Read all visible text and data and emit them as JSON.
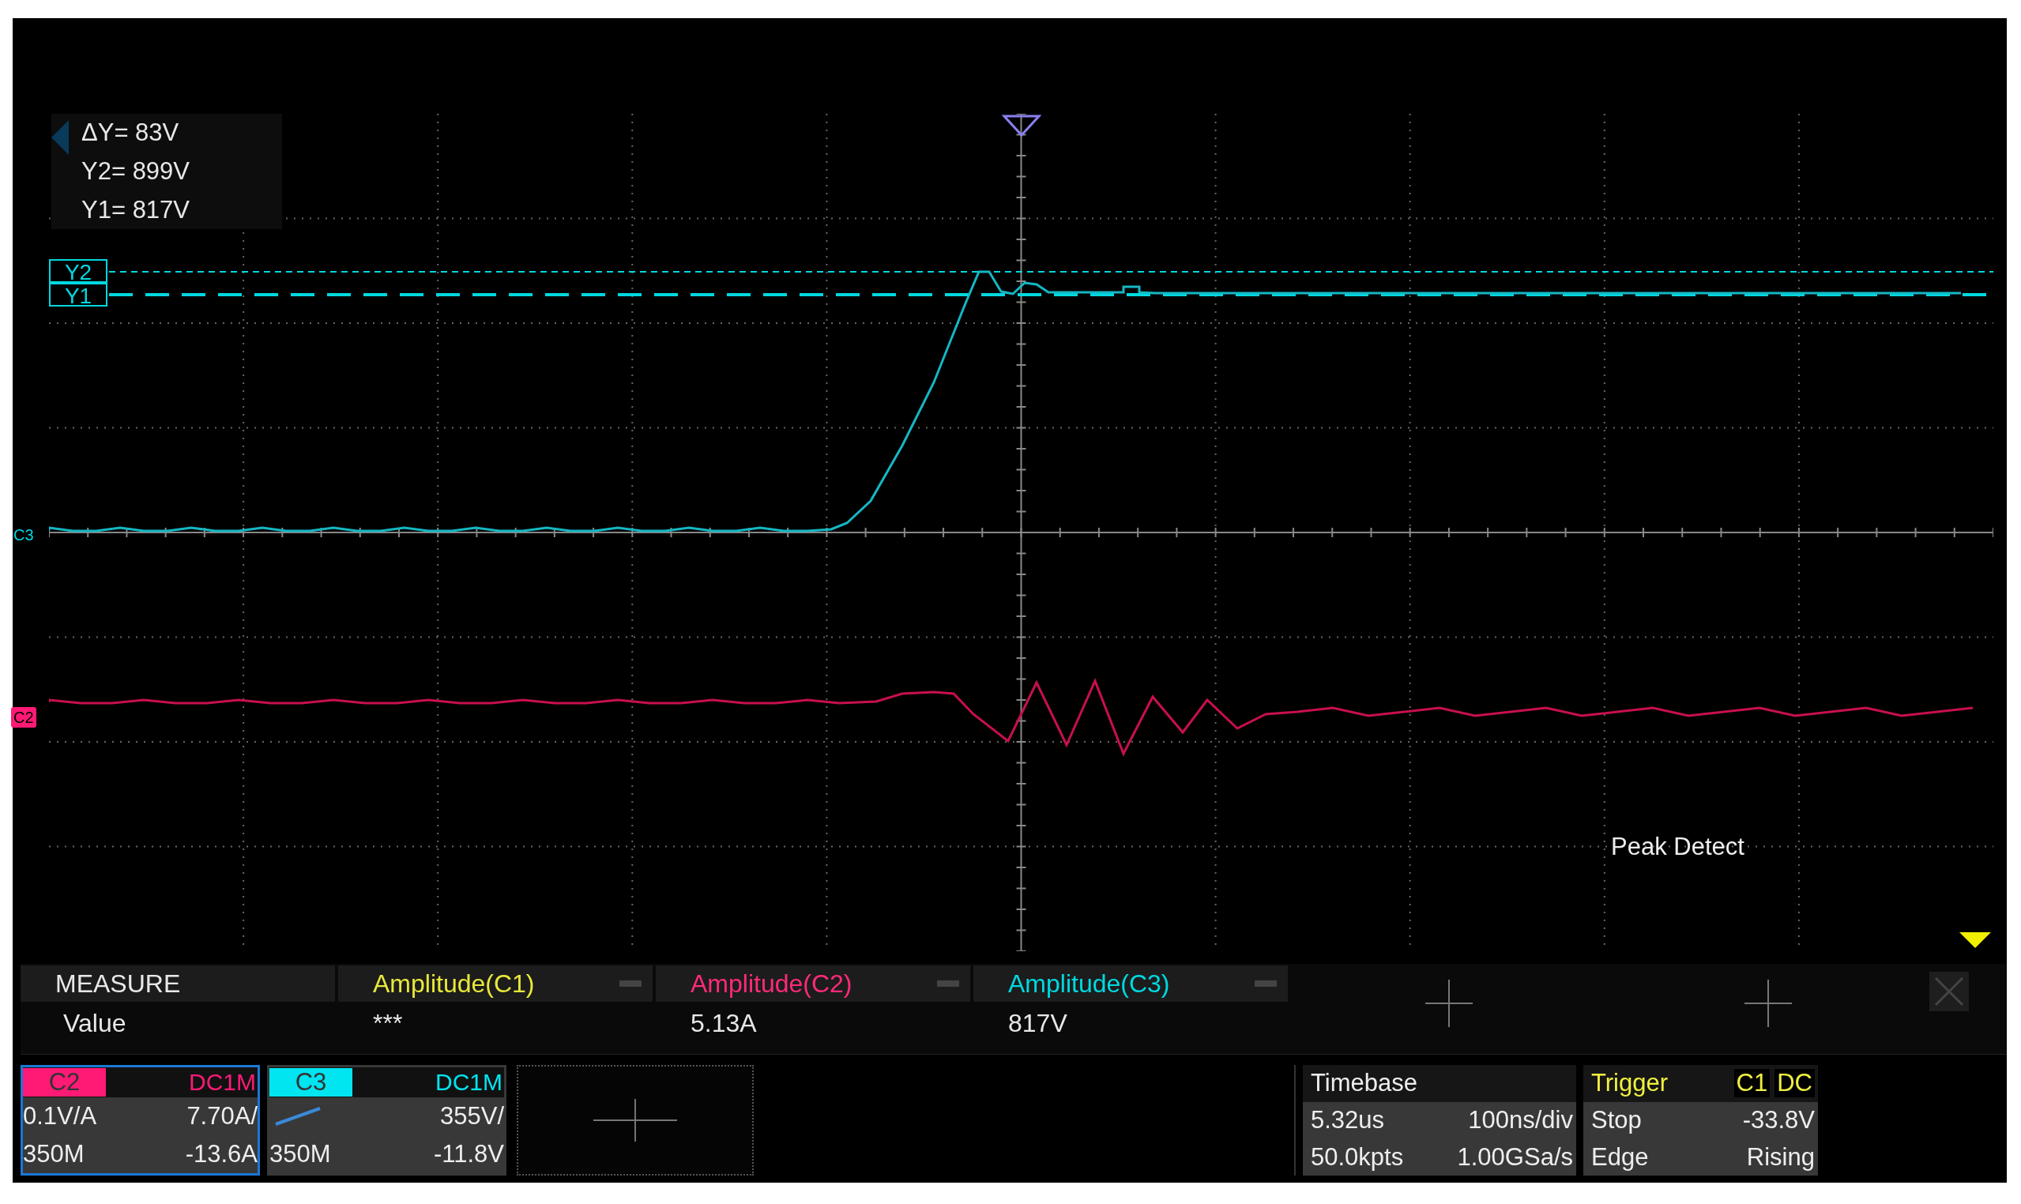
{
  "cursor_readout": {
    "lines": [
      "ΔY= 83V",
      "Y2= 899V",
      "Y1= 817V"
    ]
  },
  "plot": {
    "cursor_tags": [
      "Y2",
      "Y1"
    ],
    "channel_markers": [
      {
        "label": "C3",
        "color": "#00d8e0"
      },
      {
        "label": "C2",
        "color": "#ff1a75"
      }
    ],
    "acquisition_mode": "Peak Detect"
  },
  "measure": {
    "header": "MEASURE",
    "row_label": "Value",
    "items": [
      {
        "label": "Amplitude(C1)",
        "value": "***",
        "color": "#e8e83a"
      },
      {
        "label": "Amplitude(C2)",
        "value": "5.13A",
        "color": "#ff2a7a"
      },
      {
        "label": "Amplitude(C3)",
        "value": "817V",
        "color": "#00d8e0"
      }
    ]
  },
  "channels": [
    {
      "name": "C2",
      "coupling": "DC1M",
      "probe": "0.1V/A",
      "scale": "7.70A/",
      "bandwidth": "350M",
      "offset": "-13.6A",
      "color": "#ff1a75",
      "selected": true
    },
    {
      "name": "C3",
      "coupling": "DC1M",
      "scale": "355V/",
      "bandwidth": "350M",
      "offset": "-11.8V",
      "color": "#00e5f0",
      "selected": false
    }
  ],
  "timebase": {
    "title": "Timebase",
    "delay": "5.32us",
    "scale": "100ns/div",
    "memory": "50.0kpts",
    "sample_rate": "1.00GSa/s"
  },
  "trigger": {
    "title": "Trigger",
    "source": "C1",
    "coupling": "DC",
    "state": "Stop",
    "trigger_level": "-33.8V",
    "type": "Edge",
    "slope": "Rising"
  }
}
